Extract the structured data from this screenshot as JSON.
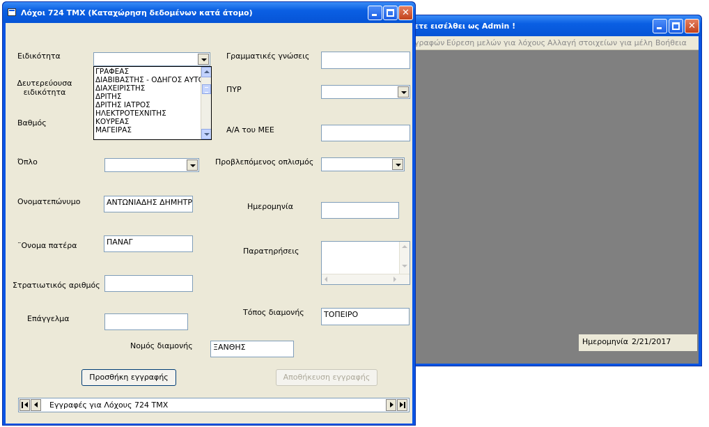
{
  "main_window": {
    "title": "ετε εισέλθει ως Admin !",
    "menu": [
      "γραφών",
      "Εύρεση μελών για λόχους",
      "Αλλαγή στοιχείων για μέλη",
      "Βοήθεια"
    ],
    "status": {
      "date_label": "Ημερομηνία",
      "date_value": "2/21/2017"
    }
  },
  "dialog": {
    "title": "Λόχοι  724  ΤΜΧ   (Καταχώρηση δεδομένων κατά  άτομο)",
    "labels": {
      "specialty": "Ειδικότητα",
      "secondary_specialty": "Δευτερεύουσα ειδικότητα",
      "rank": "Βαθμός",
      "weapon": "Όπλο",
      "full_name": "Ονοματεπώνυμο",
      "father_name": "¨Ονομα πατέρα",
      "military_number": "Στρατιωτικός αριθμός",
      "profession": "Επάγγελμα",
      "prefecture": "Νομός διαμονής",
      "literacy": "Γραμματικές γνώσεις",
      "pyr": "ΠΥΡ",
      "mee_number": "Α/Α του ΜΕΕ",
      "planned_armament": "Προβλεπόμενος οπλισμός",
      "date": "Ημερομηνία",
      "remarks": "Παρατηρήσεις",
      "residence": "Τόπος διαμονής"
    },
    "values": {
      "full_name": "ΑΝΤΩΝΙΑΔΗΣ ΔΗΜΗΤΡΙΟ",
      "father_name": "ΠΑΝΑΓ",
      "residence": "ΤΟΠΕΙΡΟ",
      "prefecture": "ΞΑΝΘΗΣ",
      "military_number": "",
      "profession": "",
      "literacy": "",
      "mee_number": "",
      "date": "",
      "remarks": ""
    },
    "specialty_list": [
      "ΓΡΑΦΕΑΣ",
      "ΔΙΑΒΙΒΑΣΤΗΣ - ΟΔΗΓΟΣ ΑΥΤΟ",
      "ΔΙΑΧΕΙΡΙΣΤΗΣ",
      "ΔΡΙΤΗΣ",
      "ΔΡΙΤΗΣ  ΙΑΤΡΟΣ",
      "ΗΛΕΚΤΡΟΤΕΧΝΙΤΗΣ",
      "ΚΟΥΡΕΑΣ",
      "ΜΑΓΕΙΡΑΣ"
    ],
    "buttons": {
      "add_record": "Προσθήκη  εγγραφής",
      "save_record": "Αποθήκευση  εγγραφής"
    },
    "navigator_caption": "Εγγραφές  για  Λόχους  724  ΤΜΧ"
  }
}
